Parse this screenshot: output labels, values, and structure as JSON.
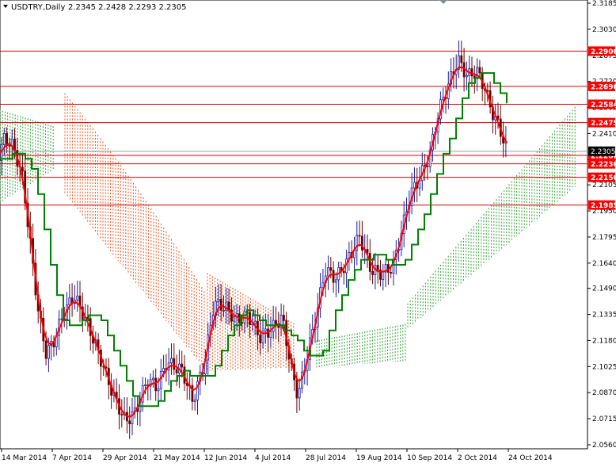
{
  "header": {
    "symbol": "USDTRY,Daily",
    "ohlc": "2.2345 2.2428 2.2293 2.2305"
  },
  "colors": {
    "up_candle": "#1a1aa6",
    "down_candle": "#6b0000",
    "tenkan": "#ff0000",
    "kijun": "#008000",
    "cloud_bear": "#e8501a",
    "cloud_bull": "#2e9e2e",
    "level_line": "#d40000",
    "level_label_bg": "#ff0000",
    "current_line": "#8aa3a3"
  },
  "chart_data": {
    "type": "candlestick",
    "instrument": "USDTRY",
    "timeframe": "Daily",
    "ylim": [
      2.056,
      2.3185
    ],
    "y_ticks": [
      "2.3185",
      "2.3030",
      "2.2875",
      "2.2720",
      "2.2565",
      "2.2410",
      "2.2255",
      "2.2105",
      "2.1950",
      "2.1795",
      "2.1640",
      "2.1490",
      "2.1335",
      "2.1180",
      "2.1025",
      "2.0870",
      "2.0715",
      "2.0560"
    ],
    "x_ticks": [
      "14 Mar 2014",
      "7 Apr 2014",
      "29 Apr 2014",
      "21 May 2014",
      "12 Jun 2014",
      "4 Jul 2014",
      "28 Jul 2014",
      "19 Aug 2014",
      "10 Sep 2014",
      "2 Oct 2014",
      "24 Oct 2014"
    ],
    "horizontal_levels": [
      "2.2900",
      "2.2690",
      "2.2584",
      "2.2475",
      "2.2280",
      "2.2230",
      "2.2150",
      "2.1985"
    ],
    "current_price": "2.2305",
    "series": [
      {
        "name": "Tenkan-sen",
        "role": "tenkan"
      },
      {
        "name": "Kijun-sen",
        "role": "kijun"
      },
      {
        "name": "Kumo",
        "role": "cloud"
      }
    ]
  }
}
